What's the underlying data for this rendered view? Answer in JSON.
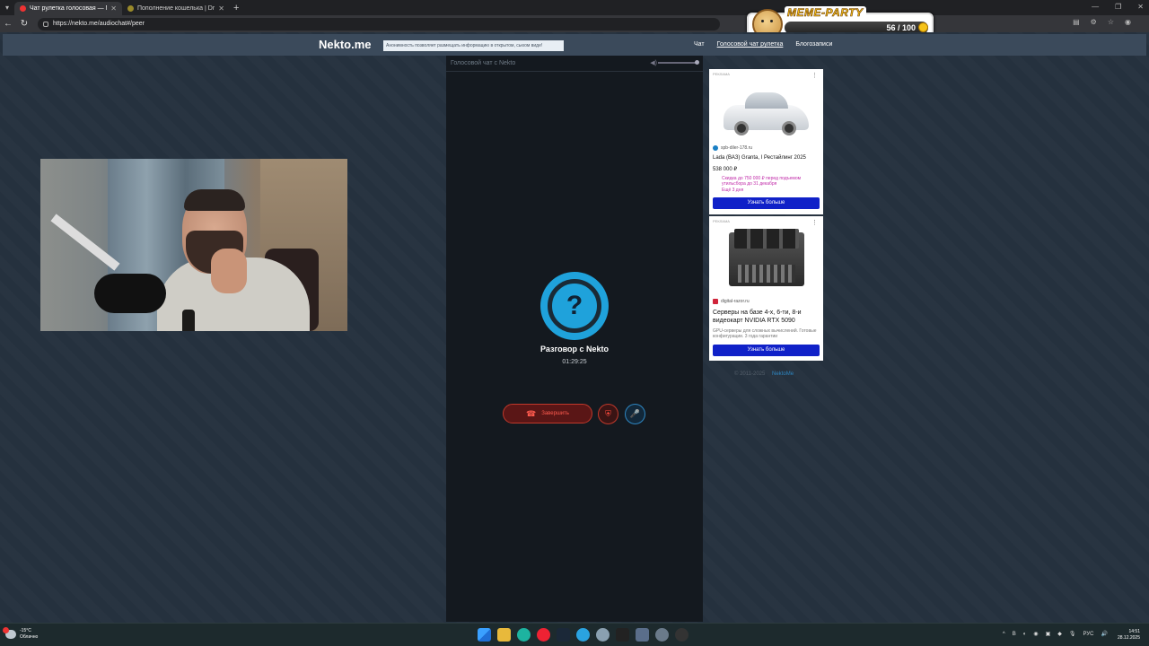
{
  "browser": {
    "tabs": [
      {
        "title": "Чат рулетка голосовая — N",
        "active": true
      },
      {
        "title": "Пополнение кошелька | Dragon",
        "active": false
      }
    ],
    "url": "https://nekto.me/audiochat#/peer"
  },
  "overlay": {
    "title": "MEME-PARTY",
    "count": "56 / 100"
  },
  "site": {
    "logo": "Nekto.me",
    "notice": "Анонимность позволяет размещать информацию в открытом, сьюом виде!",
    "menu": [
      "Чат",
      "Голосовой чат рулетка",
      "Блогозаписи"
    ]
  },
  "chat": {
    "header": "Голосовой чат с Nekto",
    "avatar_glyph": "?",
    "title": "Разговор с Nekto",
    "timer": "01:29:25",
    "end_label": "Завершить"
  },
  "ads": [
    {
      "label": "РЕКЛАМА",
      "source": "spb-diler-178.ru",
      "headline": "Lada (ВАЗ) Granta, I Рестайлинг 2025",
      "price": "538 000 ₽",
      "promo": "Скидка до 750 000 ₽ перед подъемом утильсбора до 31 декабря",
      "promo_extra": "Ещё 3 дня",
      "cta": "Узнать больше",
      "icon_color": "#1a7fc4"
    },
    {
      "label": "РЕКЛАМА",
      "source": "digital-razor.ru",
      "headline": "Серверы на базе 4-х, 6-ти, 8-и видеокарт NVIDIA RTX 5090",
      "description": "GPU-серверы для сложных вычислений. Готовые конфигурации. 3 года гарантии",
      "cta": "Узнать больше",
      "icon_color": "#d0243a"
    }
  ],
  "footer": {
    "copyright": "© 2011-2025",
    "link": "NektoMe"
  },
  "taskbar": {
    "temp": "-15°C",
    "weather": "Облачно",
    "lang": "РУС",
    "time": "14:51",
    "date": "28.12.2025"
  },
  "colors": {
    "accent": "#1fa2db",
    "danger": "#c0392b",
    "cta": "#1021c8"
  }
}
